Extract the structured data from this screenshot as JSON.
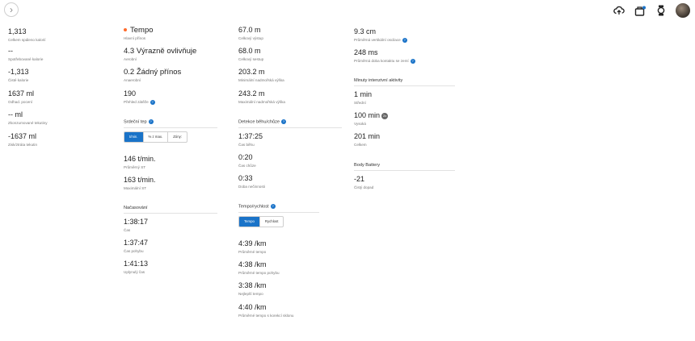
{
  "topbar": {
    "back_glyph": "›",
    "icons": [
      "upload-icon",
      "device-icon",
      "watch-icon",
      "avatar"
    ]
  },
  "col1": [
    {
      "value": "1,313",
      "label": "Celkem spáleno kalorií"
    },
    {
      "value": "--",
      "label": "Spotřebované kalorie"
    },
    {
      "value": "-1,313",
      "label": "Čisté kalorie"
    },
    {
      "value": "1637 ml",
      "label": "Odhad. pocení"
    },
    {
      "value": "-- ml",
      "label": "Zkonzumované tekutiny"
    },
    {
      "value": "-1637 ml",
      "label": "Zisk/ztráta tekutin"
    }
  ],
  "col2": {
    "effect": [
      {
        "value": "Tempo",
        "label": "Hlavní přínos"
      },
      {
        "value": "4.3 Výrazně ovlivňuje",
        "label": "Aerobní"
      },
      {
        "value": "0.2 Žádný přínos",
        "label": "Anaerobní"
      },
      {
        "value": "190",
        "label": "Přehled zátěže"
      }
    ],
    "hr_title": "Srdeční tep",
    "hr_tabs": [
      "t/min.",
      "% z max.",
      "Zóny:"
    ],
    "hr": [
      {
        "value": "146 t/min.",
        "label": "Průměrný ST"
      },
      {
        "value": "163 t/min.",
        "label": "Maximální ST"
      }
    ],
    "timing_title": "Načasování",
    "timing": [
      {
        "value": "1:38:17",
        "label": "Čas"
      },
      {
        "value": "1:37:47",
        "label": "Čas pohybu"
      },
      {
        "value": "1:41:13",
        "label": "Uplynulý čas"
      }
    ]
  },
  "col3": {
    "elevation": [
      {
        "value": "67.0 m",
        "label": "Celkový výstup"
      },
      {
        "value": "68.0 m",
        "label": "Celkový sestup"
      },
      {
        "value": "203.2 m",
        "label": "Minimální nadmořská výška"
      },
      {
        "value": "243.2 m",
        "label": "Maximální nadmořská výška"
      }
    ],
    "runwalk_title": "Detekce běhu/chůze",
    "runwalk": [
      {
        "value": "1:37:25",
        "label": "Čas běhu"
      },
      {
        "value": "0:20",
        "label": "Čas chůze"
      },
      {
        "value": "0:33",
        "label": "Doba nečinnosti"
      }
    ],
    "pace_title": "Tempo/rychlost",
    "pace_tabs": [
      "Tempo",
      "Rychlost"
    ],
    "pace": [
      {
        "value": "4:39 /km",
        "label": "Průměrné tempo"
      },
      {
        "value": "4:38 /km",
        "label": "Průměrné tempo pohybu"
      },
      {
        "value": "3:38 /km",
        "label": "Nejlepší tempo"
      },
      {
        "value": "4:40 /km",
        "label": "Průměrné tempo s korekcí sklonu"
      }
    ]
  },
  "col4": {
    "dynamics": [
      {
        "value": "9.3 cm",
        "label": "Průměrná vertikální oscilace"
      },
      {
        "value": "248 ms",
        "label": "Průměrná doba kontaktu se zemí"
      }
    ],
    "intensity_title": "Minuty intenzivní aktivity",
    "intensity": [
      {
        "value": "1 min",
        "label": "Střední"
      },
      {
        "value": "100 min",
        "label": "Vysoká",
        "badge": "2x"
      },
      {
        "value": "201 min",
        "label": "Celkem"
      }
    ],
    "bb_title": "Body Battery",
    "bb": [
      {
        "value": "-21",
        "label": "Čistý dopad"
      }
    ]
  },
  "colors": {
    "accent": "#1a73c8",
    "tempo_dot": "#ff6a2b"
  }
}
